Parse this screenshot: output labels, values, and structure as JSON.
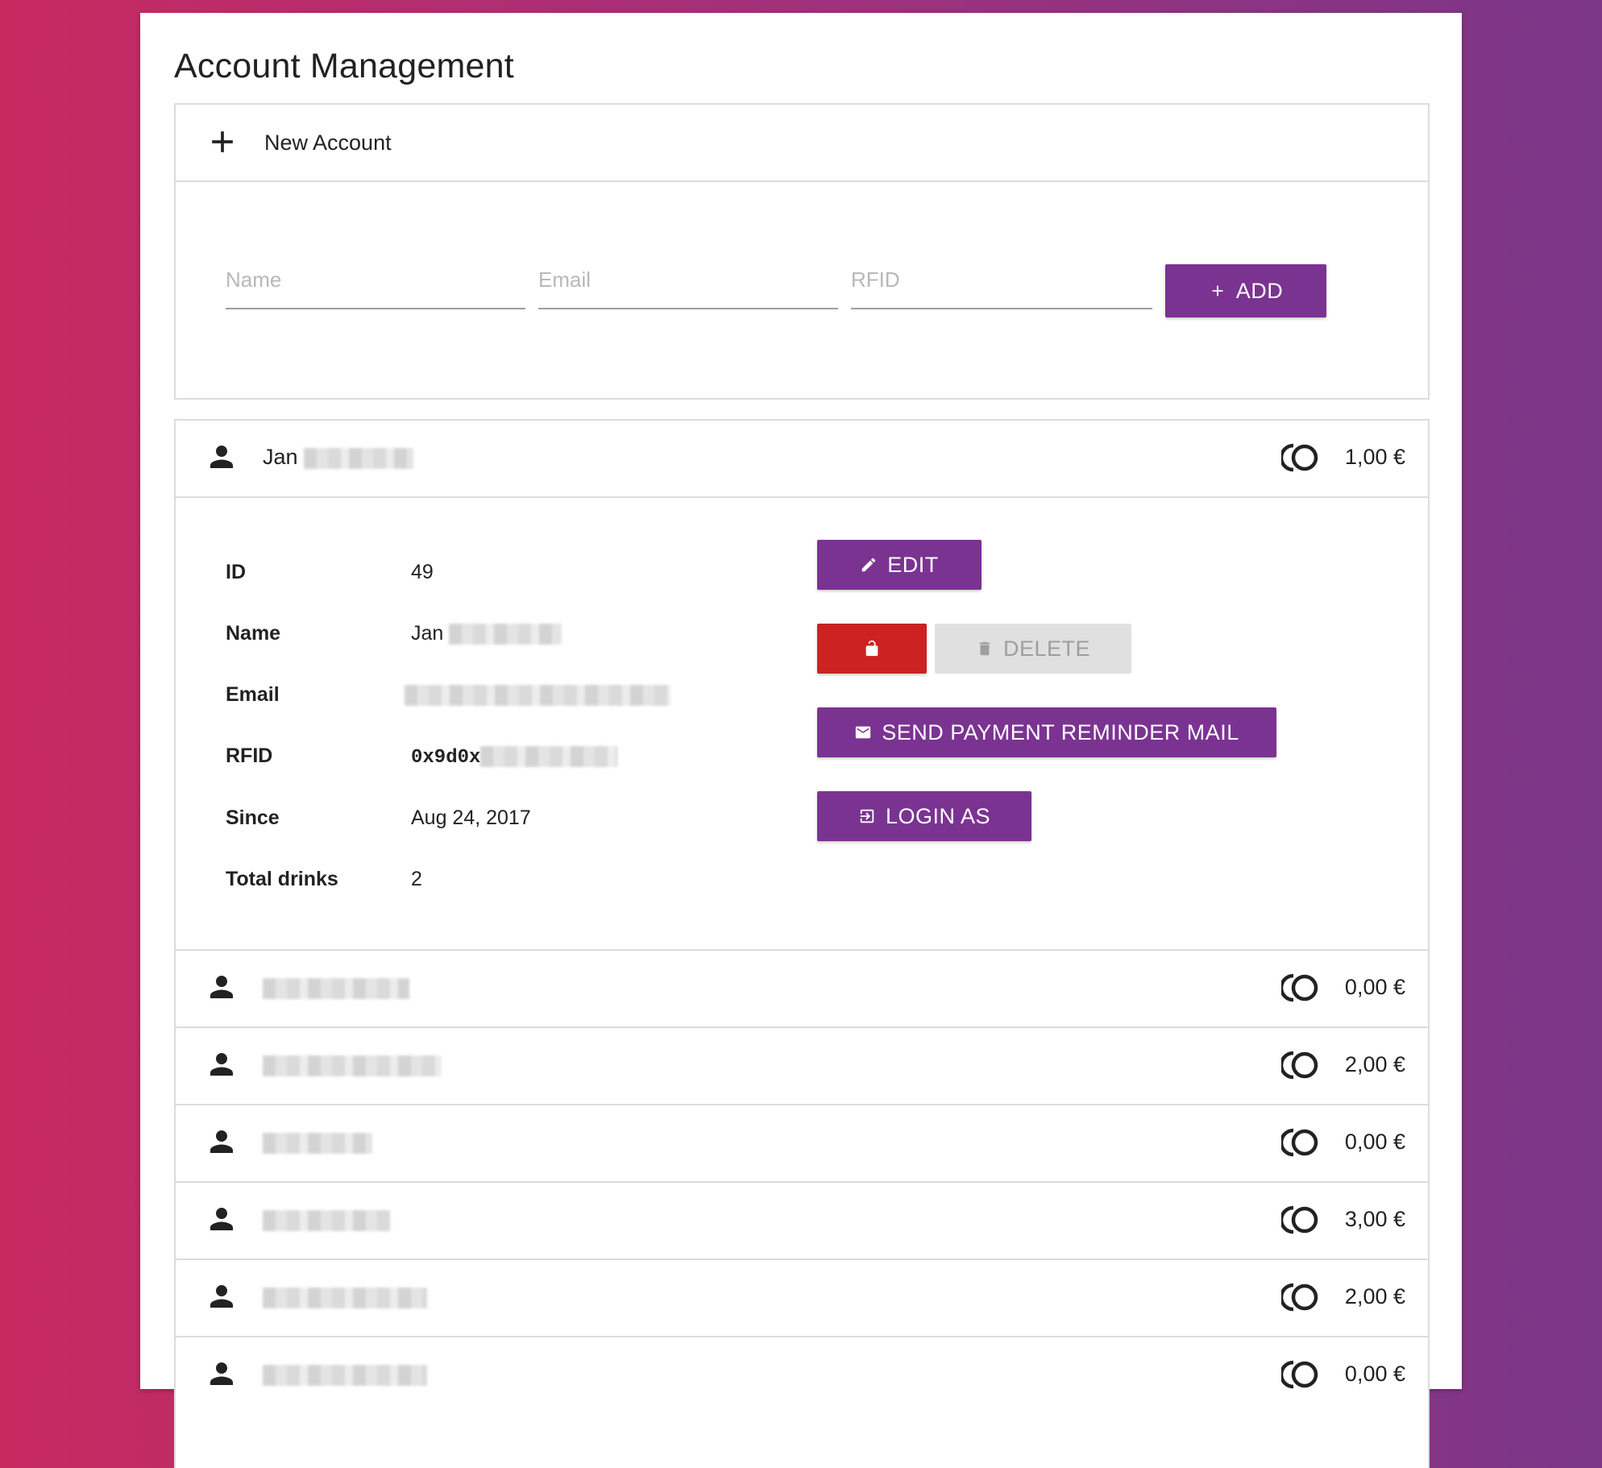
{
  "page": {
    "title": "Account Management"
  },
  "new_account": {
    "header_label": "New Account",
    "name_placeholder": "Name",
    "email_placeholder": "Email",
    "rfid_placeholder": "RFID",
    "add_label": "ADD"
  },
  "selected_account": {
    "header_name": "Jan",
    "balance": "1,00 €",
    "details": {
      "id_label": "ID",
      "id_value": "49",
      "name_label": "Name",
      "name_value": "Jan",
      "email_label": "Email",
      "rfid_label": "RFID",
      "rfid_value": "0x9d0x",
      "since_label": "Since",
      "since_value": "Aug 24, 2017",
      "drinks_label": "Total drinks",
      "drinks_value": "2"
    },
    "actions": {
      "edit_label": "EDIT",
      "delete_label": "DELETE",
      "reminder_label": "SEND PAYMENT REMINDER MAIL",
      "login_label": "LOGIN AS"
    }
  },
  "accounts": [
    {
      "balance": "0,00 €"
    },
    {
      "balance": "2,00 €"
    },
    {
      "balance": "0,00 €"
    },
    {
      "balance": "3,00 €"
    },
    {
      "balance": "2,00 €"
    },
    {
      "balance": "0,00 €"
    }
  ],
  "colors": {
    "primary": "#7b3392",
    "danger": "#cc2222",
    "disabled": "#e0e0e0"
  },
  "icons": [
    "plus-icon",
    "person-icon",
    "coins-icon",
    "pencil-icon",
    "lock-open-icon",
    "trash-icon",
    "mail-icon",
    "login-icon"
  ]
}
